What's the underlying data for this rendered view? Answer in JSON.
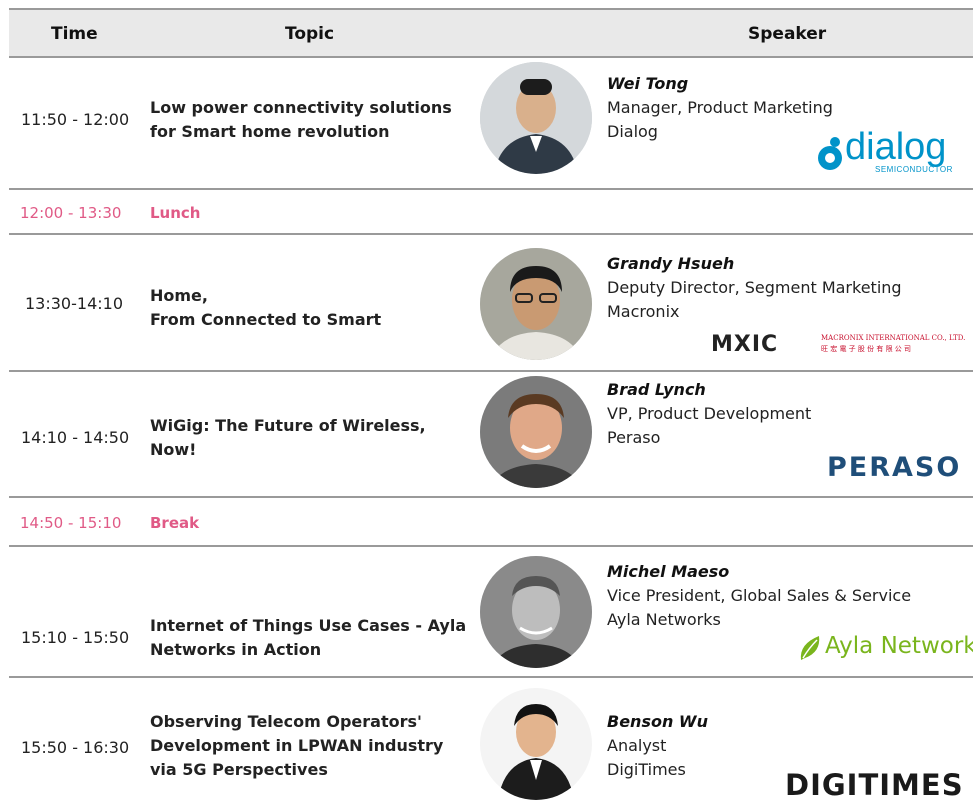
{
  "header": {
    "time": "Time",
    "topic": "Topic",
    "speaker": "Speaker"
  },
  "rows": [
    {
      "time": "11:50 - 12:00",
      "topic": "Low power connectivity solutions for Smart home revolution",
      "speaker_name": "Wei Tong",
      "speaker_title": "Manager, Product Marketing",
      "speaker_company": "Dialog",
      "logo_text": "dialog",
      "logo_sub": "SEMICONDUCTOR"
    },
    {
      "time": "12:00 - 13:30",
      "label": "Lunch"
    },
    {
      "time": "13:30-14:10",
      "topic_line1": "Home,",
      "topic_line2": "From Connected to Smart",
      "speaker_name": "Grandy Hsueh",
      "speaker_title": "Deputy Director, Segment Marketing",
      "speaker_company": "Macronix",
      "logo_text": "MXIC",
      "logo_sub": "MACRONIX INTERNATIONAL CO., LTD.",
      "logo_sub2": "旺 宏 電 子 股 份 有 限 公 司"
    },
    {
      "time": "14:10 - 14:50",
      "topic": "WiGig: The Future of Wireless, Now!",
      "speaker_name": "Brad Lynch",
      "speaker_title": "VP, Product Development",
      "speaker_company": "Peraso",
      "logo_text": "PERASO"
    },
    {
      "time": "14:50 - 15:10",
      "label": "Break"
    },
    {
      "time": "15:10 - 15:50",
      "topic": "Internet of Things Use Cases - Ayla Networks in Action",
      "speaker_name": "Michel Maeso",
      "speaker_title": "Vice President, Global Sales & Service",
      "speaker_company": "Ayla Networks",
      "logo_text": "Ayla Networks"
    },
    {
      "time": "15:50 - 16:30",
      "topic": "Observing Telecom Operators' Development in LPWAN industry via 5G Perspectives",
      "speaker_name": "Benson Wu",
      "speaker_title": "Analyst",
      "speaker_company": "DigiTimes",
      "logo_text": "DIGITIMES"
    }
  ],
  "colors": {
    "accent_break": "#e05a86",
    "dialog_blue": "#0093c9",
    "mxic_red": "#c8102e",
    "peraso_blue": "#1f4e79",
    "ayla_green": "#7ab51d"
  }
}
